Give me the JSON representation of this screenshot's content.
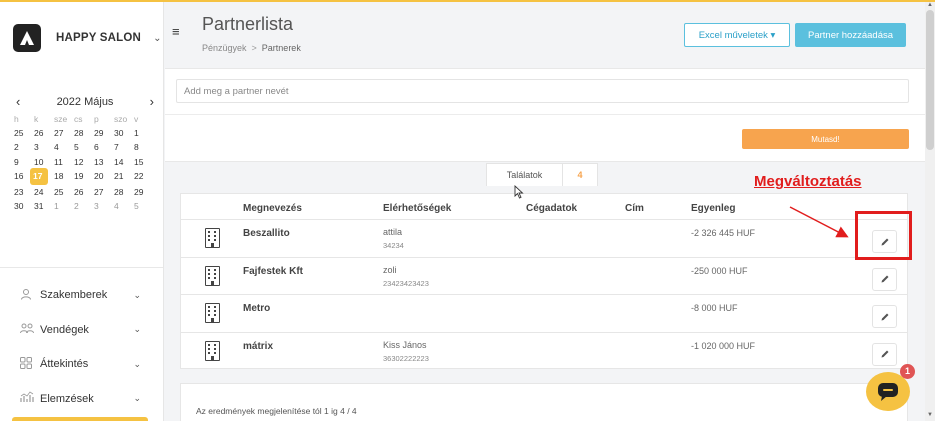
{
  "brand": {
    "name": "HAPPY SALON",
    "caret": "⌄"
  },
  "calendar": {
    "prev": "‹",
    "next": "›",
    "title": "2022 Május",
    "weekdays": [
      "h",
      "k",
      "sze",
      "cs",
      "p",
      "szo",
      "v"
    ],
    "weeks": [
      [
        "25",
        "26",
        "27",
        "28",
        "29",
        "30",
        "1"
      ],
      [
        "2",
        "3",
        "4",
        "5",
        "6",
        "7",
        "8"
      ],
      [
        "9",
        "10",
        "11",
        "12",
        "13",
        "14",
        "15"
      ],
      [
        "16",
        "17",
        "18",
        "19",
        "20",
        "21",
        "22"
      ],
      [
        "23",
        "24",
        "25",
        "26",
        "27",
        "28",
        "29"
      ],
      [
        "30",
        "31",
        "1",
        "2",
        "3",
        "4",
        "5"
      ]
    ],
    "today": "17"
  },
  "nav": {
    "items": [
      {
        "label": "Szakemberek",
        "icon": "person-icon"
      },
      {
        "label": "Vendégek",
        "icon": "people-icon"
      },
      {
        "label": "Áttekintés",
        "icon": "grid-icon"
      },
      {
        "label": "Elemzések",
        "icon": "chart-icon"
      }
    ]
  },
  "header": {
    "title": "Partnerlista",
    "breadcrumb": [
      "Pénzügyek",
      "Partnerek"
    ],
    "breadcrumb_sep": ">",
    "excel_label": "Excel műveletek ▾",
    "add_label": "Partner hozzáadása"
  },
  "search": {
    "placeholder": "Add meg a partner nevét",
    "show_label": "Mutasd!"
  },
  "results": {
    "label": "Találatok",
    "count": "4"
  },
  "table": {
    "columns": [
      "Megnevezés",
      "Elérhetőségek",
      "Cégadatok",
      "Cím",
      "Egyenleg"
    ],
    "rows": [
      {
        "name": "Beszallito",
        "contact": "attila",
        "phone": "34234",
        "balance": "-2 326 445 HUF"
      },
      {
        "name": "Fajfestek Kft",
        "contact": "zoli",
        "phone": "23423423423",
        "balance": "-250 000 HUF"
      },
      {
        "name": "Metro",
        "contact": "",
        "phone": "",
        "balance": "-8 000 HUF"
      },
      {
        "name": "mátrix",
        "contact": "Kiss János",
        "phone": "36302222223",
        "balance": "-1 020 000 HUF"
      }
    ]
  },
  "footer": {
    "text": "Az eredmények megjelenítése tól 1 ig 4 / 4"
  },
  "annotation": {
    "label": "Megváltoztatás",
    "color": "#e11d1d"
  },
  "chat": {
    "badge": "1"
  },
  "colors": {
    "accent": "#f5c242",
    "info": "#5bc0de",
    "orange": "#f7a44e"
  }
}
